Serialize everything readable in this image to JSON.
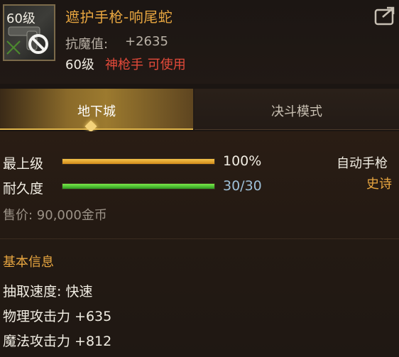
{
  "item": {
    "level_badge": "60级",
    "name": "遮护手枪-响尾蛇",
    "resist_label": "抗魔值:",
    "resist_value": "+2635",
    "req_level": "60级",
    "req_class": "神枪手 可使用"
  },
  "tabs": [
    {
      "label": "地下城",
      "active": true
    },
    {
      "label": "决斗模式",
      "active": false
    }
  ],
  "stats": {
    "grade": {
      "label": "最上级",
      "value": "100%",
      "fraction": 1.0
    },
    "durability": {
      "label": "耐久度",
      "value": "30/30",
      "fraction": 1.0
    }
  },
  "item_type": "自动手枪",
  "rarity": "史诗",
  "price": "售价: 90,000金币",
  "section_title": "基本信息",
  "attributes": [
    "抽取速度: 快速",
    "物理攻击力 +635",
    "魔法攻击力 +812"
  ],
  "colors": {
    "gold_text": "#e8a640",
    "red_text": "#e34a3a",
    "grade_bar": "#e0a030",
    "durability_bar": "#4cc832",
    "durability_text": "#9ec0d8"
  },
  "icons": [
    "pistol-icon",
    "share-icon",
    "disabled-icon"
  ]
}
